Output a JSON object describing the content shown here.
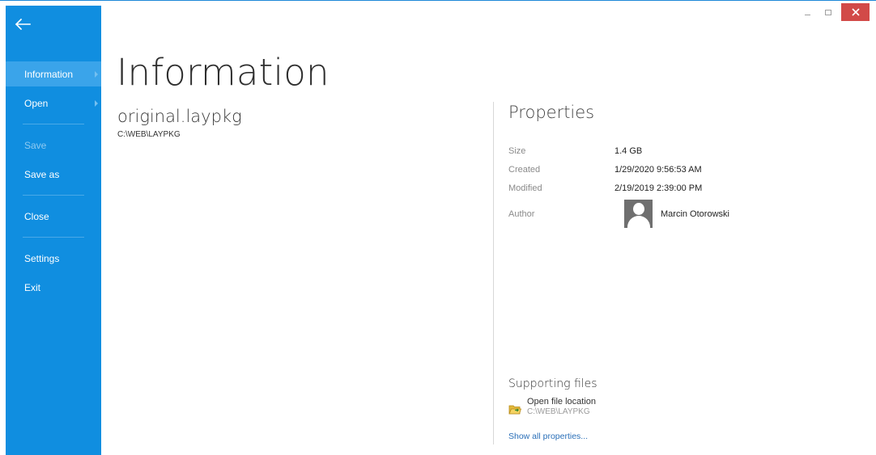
{
  "sidebar": {
    "back_icon": "arrow-left-icon",
    "items": [
      {
        "label": "Information"
      },
      {
        "label": "Open"
      },
      {
        "label": "Save"
      },
      {
        "label": "Save as"
      },
      {
        "label": "Close"
      },
      {
        "label": "Settings"
      },
      {
        "label": "Exit"
      }
    ]
  },
  "window_controls": {
    "minimize_icon": "minimize-icon",
    "maximize_icon": "maximize-icon",
    "close_icon": "close-icon"
  },
  "main": {
    "title": "Information",
    "file_name": "original.laypkg",
    "file_path": "C:\\WEB\\LAYPKG"
  },
  "properties": {
    "title": "Properties",
    "rows": [
      {
        "label": "Size",
        "value": "1.4 GB"
      },
      {
        "label": "Created",
        "value": "1/29/2020 9:56:53 AM"
      },
      {
        "label": "Modified",
        "value": "2/19/2019 2:39:00 PM"
      }
    ],
    "author_label": "Author",
    "author_name": "Marcin Otorowski"
  },
  "supporting": {
    "title": "Supporting files",
    "open_location_label": "Open file location",
    "open_location_path": "C:\\WEB\\LAYPKG",
    "show_all_label": "Show all properties..."
  },
  "colors": {
    "sidebar": "#108ee0",
    "sidebar_active": "#3aa4ea",
    "close_button": "#d24a48",
    "link": "#2a6fb8"
  }
}
